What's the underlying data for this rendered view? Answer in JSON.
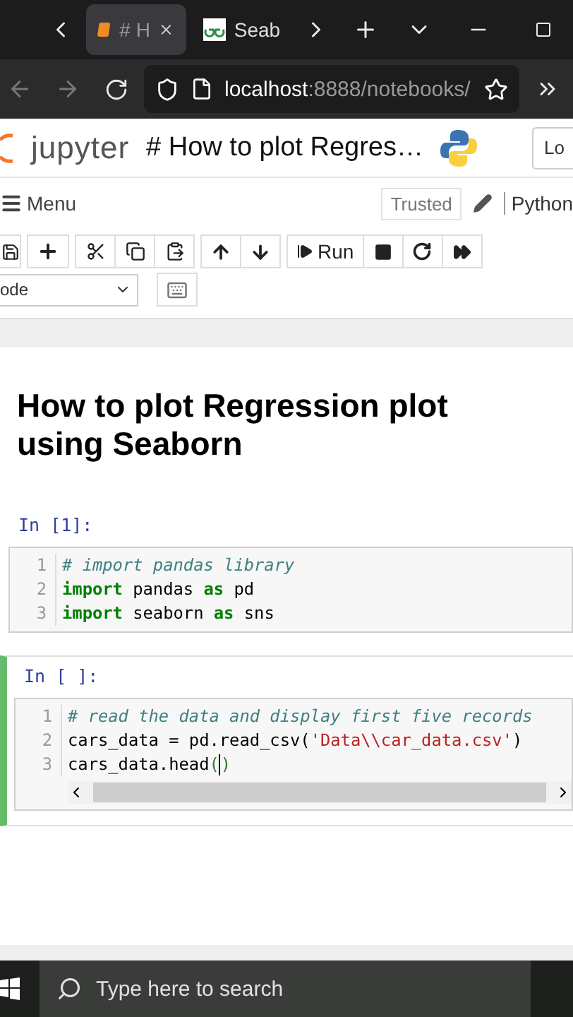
{
  "browser": {
    "tabs": [
      {
        "title": "# H",
        "selected": true,
        "closable": true
      },
      {
        "title": "Seab",
        "selected": false,
        "closable": false
      }
    ],
    "url": {
      "host": "localhost",
      "path": ":8888/notebooks/"
    }
  },
  "header": {
    "logo_text": "jupyter",
    "notebook_title": "# How to plot Regres…",
    "logout_button": "Lo"
  },
  "menubar": {
    "menu": "Menu",
    "trusted": "Trusted",
    "kernel": "Python"
  },
  "toolbar": {
    "run_label": "Run",
    "cell_type": "ode"
  },
  "cells": [
    {
      "kind": "markdown",
      "heading": "How to plot Regression plot using Seaborn"
    },
    {
      "kind": "code",
      "prompt": "In [1]:",
      "selected": false,
      "lines": [
        {
          "number": "1",
          "tokens": [
            {
              "kind": "comment",
              "text": "# import pandas library"
            }
          ]
        },
        {
          "number": "2",
          "tokens": [
            {
              "kind": "keyword",
              "text": "import"
            },
            {
              "kind": "plain",
              "text": " pandas "
            },
            {
              "kind": "keyword",
              "text": "as"
            },
            {
              "kind": "plain",
              "text": " pd"
            }
          ]
        },
        {
          "number": "3",
          "tokens": [
            {
              "kind": "keyword",
              "text": "import"
            },
            {
              "kind": "plain",
              "text": " seaborn "
            },
            {
              "kind": "keyword",
              "text": "as"
            },
            {
              "kind": "plain",
              "text": " sns"
            }
          ]
        }
      ]
    },
    {
      "kind": "code",
      "prompt": "In [ ]:",
      "selected": true,
      "lines": [
        {
          "number": "1",
          "tokens": [
            {
              "kind": "comment",
              "text": "# read the data and display first five records"
            }
          ]
        },
        {
          "number": "2",
          "tokens": [
            {
              "kind": "plain",
              "text": "cars_data = pd.read_csv("
            },
            {
              "kind": "string",
              "text": "'Data\\\\car_data.csv'"
            },
            {
              "kind": "plain",
              "text": ")"
            }
          ]
        },
        {
          "number": "3",
          "tokens": [
            {
              "kind": "plain",
              "text": "cars_data.head"
            },
            {
              "kind": "bracket",
              "text": "("
            },
            {
              "kind": "bracket",
              "text": ")",
              "cursor_before": true
            }
          ]
        }
      ]
    }
  ],
  "taskbar": {
    "search_placeholder": "Type here to search"
  }
}
